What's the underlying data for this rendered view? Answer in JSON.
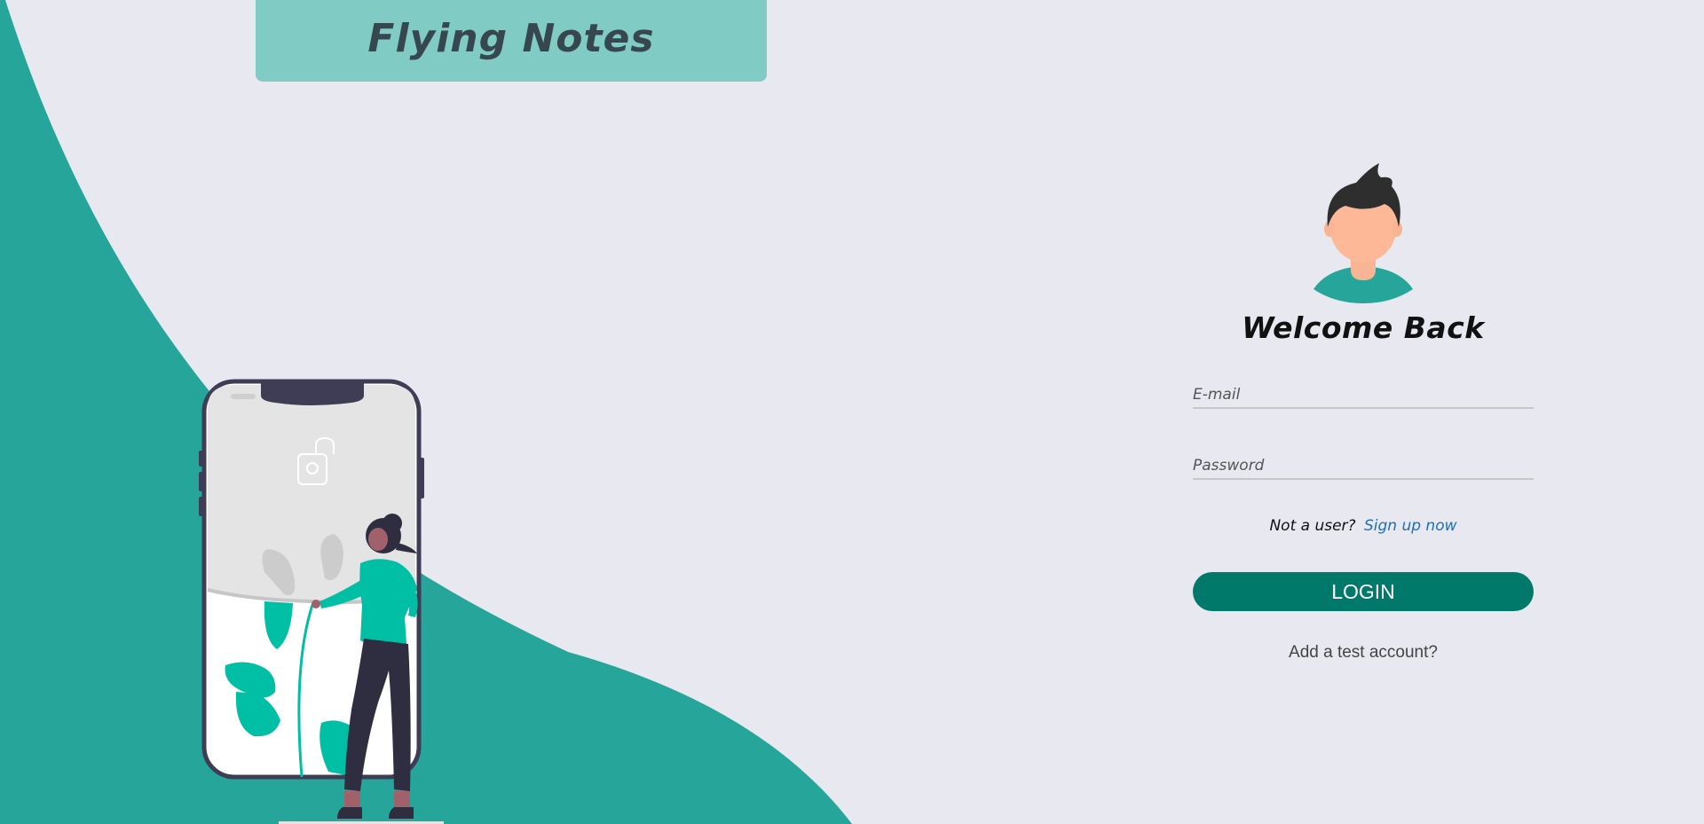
{
  "brand": {
    "title": "Flying Notes"
  },
  "login": {
    "heading": "Welcome Back",
    "email_placeholder": "E-mail",
    "password_placeholder": "Password",
    "signup_prompt": "Not a user?",
    "signup_link": "Sign up now",
    "login_button": "LOGIN",
    "test_account_link": "Add a test account?"
  },
  "colors": {
    "background": "#e7e8f0",
    "wave": "#26a69a",
    "banner": "#80cbc4",
    "button": "#00796b",
    "link": "#1e6fb8"
  },
  "icons": {
    "avatar": "user-avatar-icon",
    "lock": "unlock-icon"
  }
}
